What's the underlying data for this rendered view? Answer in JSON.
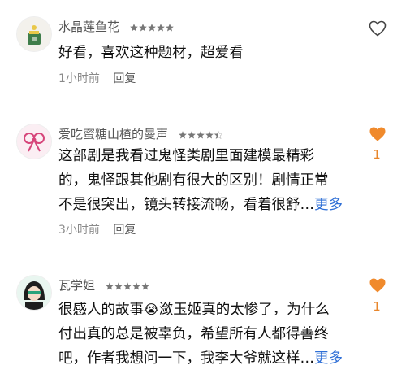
{
  "colors": {
    "accent": "#f08a2c",
    "link": "#2f6fd6",
    "meta": "#8a8a8a"
  },
  "comments": [
    {
      "user": "水晶莲鱼花",
      "rating": 5,
      "text_lines": [
        "好看，喜欢这种题材，超爱看"
      ],
      "more": "",
      "time": "1小时前",
      "reply": "回复",
      "liked": false,
      "likes": ""
    },
    {
      "user": "爱吃蜜糖山楂的曼声",
      "rating": 4.5,
      "text_lines": [
        "这部剧是我看过鬼怪类剧里面建模最精彩",
        "的，鬼怪跟其他剧有很大的区别！剧情正常",
        "不是很突出，镜头转接流畅，看着很舒…"
      ],
      "more": "更多",
      "time": "3小时前",
      "reply": "回复",
      "liked": true,
      "likes": "1"
    },
    {
      "user": "瓦学姐",
      "rating": 5,
      "text_part1": "很感人的故事",
      "emoji": "😭",
      "text_part2": "潋玉姬真的太惨了，为什么",
      "text_lines": [
        "付出真的总是被辜负，希望所有人都得善终",
        "吧，作者我想问一下，我李大爷就这样…"
      ],
      "more": "更多",
      "liked": true,
      "likes": "1"
    }
  ]
}
